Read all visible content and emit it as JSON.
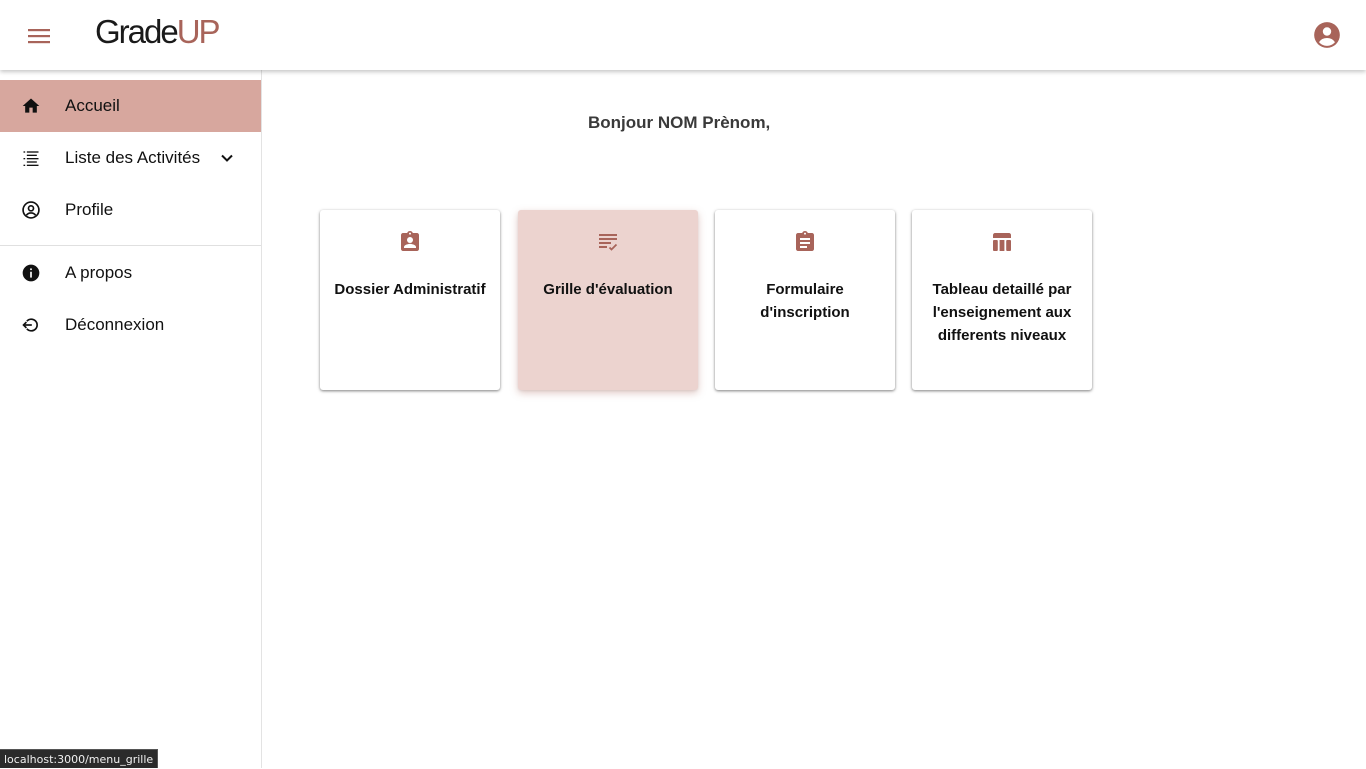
{
  "app": {
    "logo_main": "Grade",
    "logo_accent": "UP"
  },
  "header": {
    "menu_icon": "menu-icon",
    "account_icon": "account-circle-icon"
  },
  "sidebar": {
    "items": [
      {
        "label": "Accueil",
        "icon": "home-icon",
        "active": true
      },
      {
        "label": "Liste des Activités",
        "icon": "list-icon",
        "expandable": true
      },
      {
        "label": "Profile",
        "icon": "account-circle-outline-icon"
      },
      {
        "label": "A propos",
        "icon": "info-icon"
      },
      {
        "label": "Déconnexion",
        "icon": "logout-icon"
      }
    ]
  },
  "main": {
    "greeting": "Bonjour NOM Prènom,",
    "cards": [
      {
        "label": "Dossier Administratif",
        "icon": "assignment-ind-icon"
      },
      {
        "label": "Grille d'évaluation",
        "icon": "checklist-icon",
        "hovered": true
      },
      {
        "label": "Formulaire d'inscription",
        "icon": "assignment-icon"
      },
      {
        "label": "Tableau detaillé par l'enseignement aux differents niveaux",
        "icon": "table-chart-icon"
      }
    ]
  },
  "status_bar": {
    "url": "localhost:3000/menu_grille"
  },
  "colors": {
    "accent": "#a8645a",
    "active_nav": "#d7a79e",
    "card_hover": "#ecd3cf"
  }
}
